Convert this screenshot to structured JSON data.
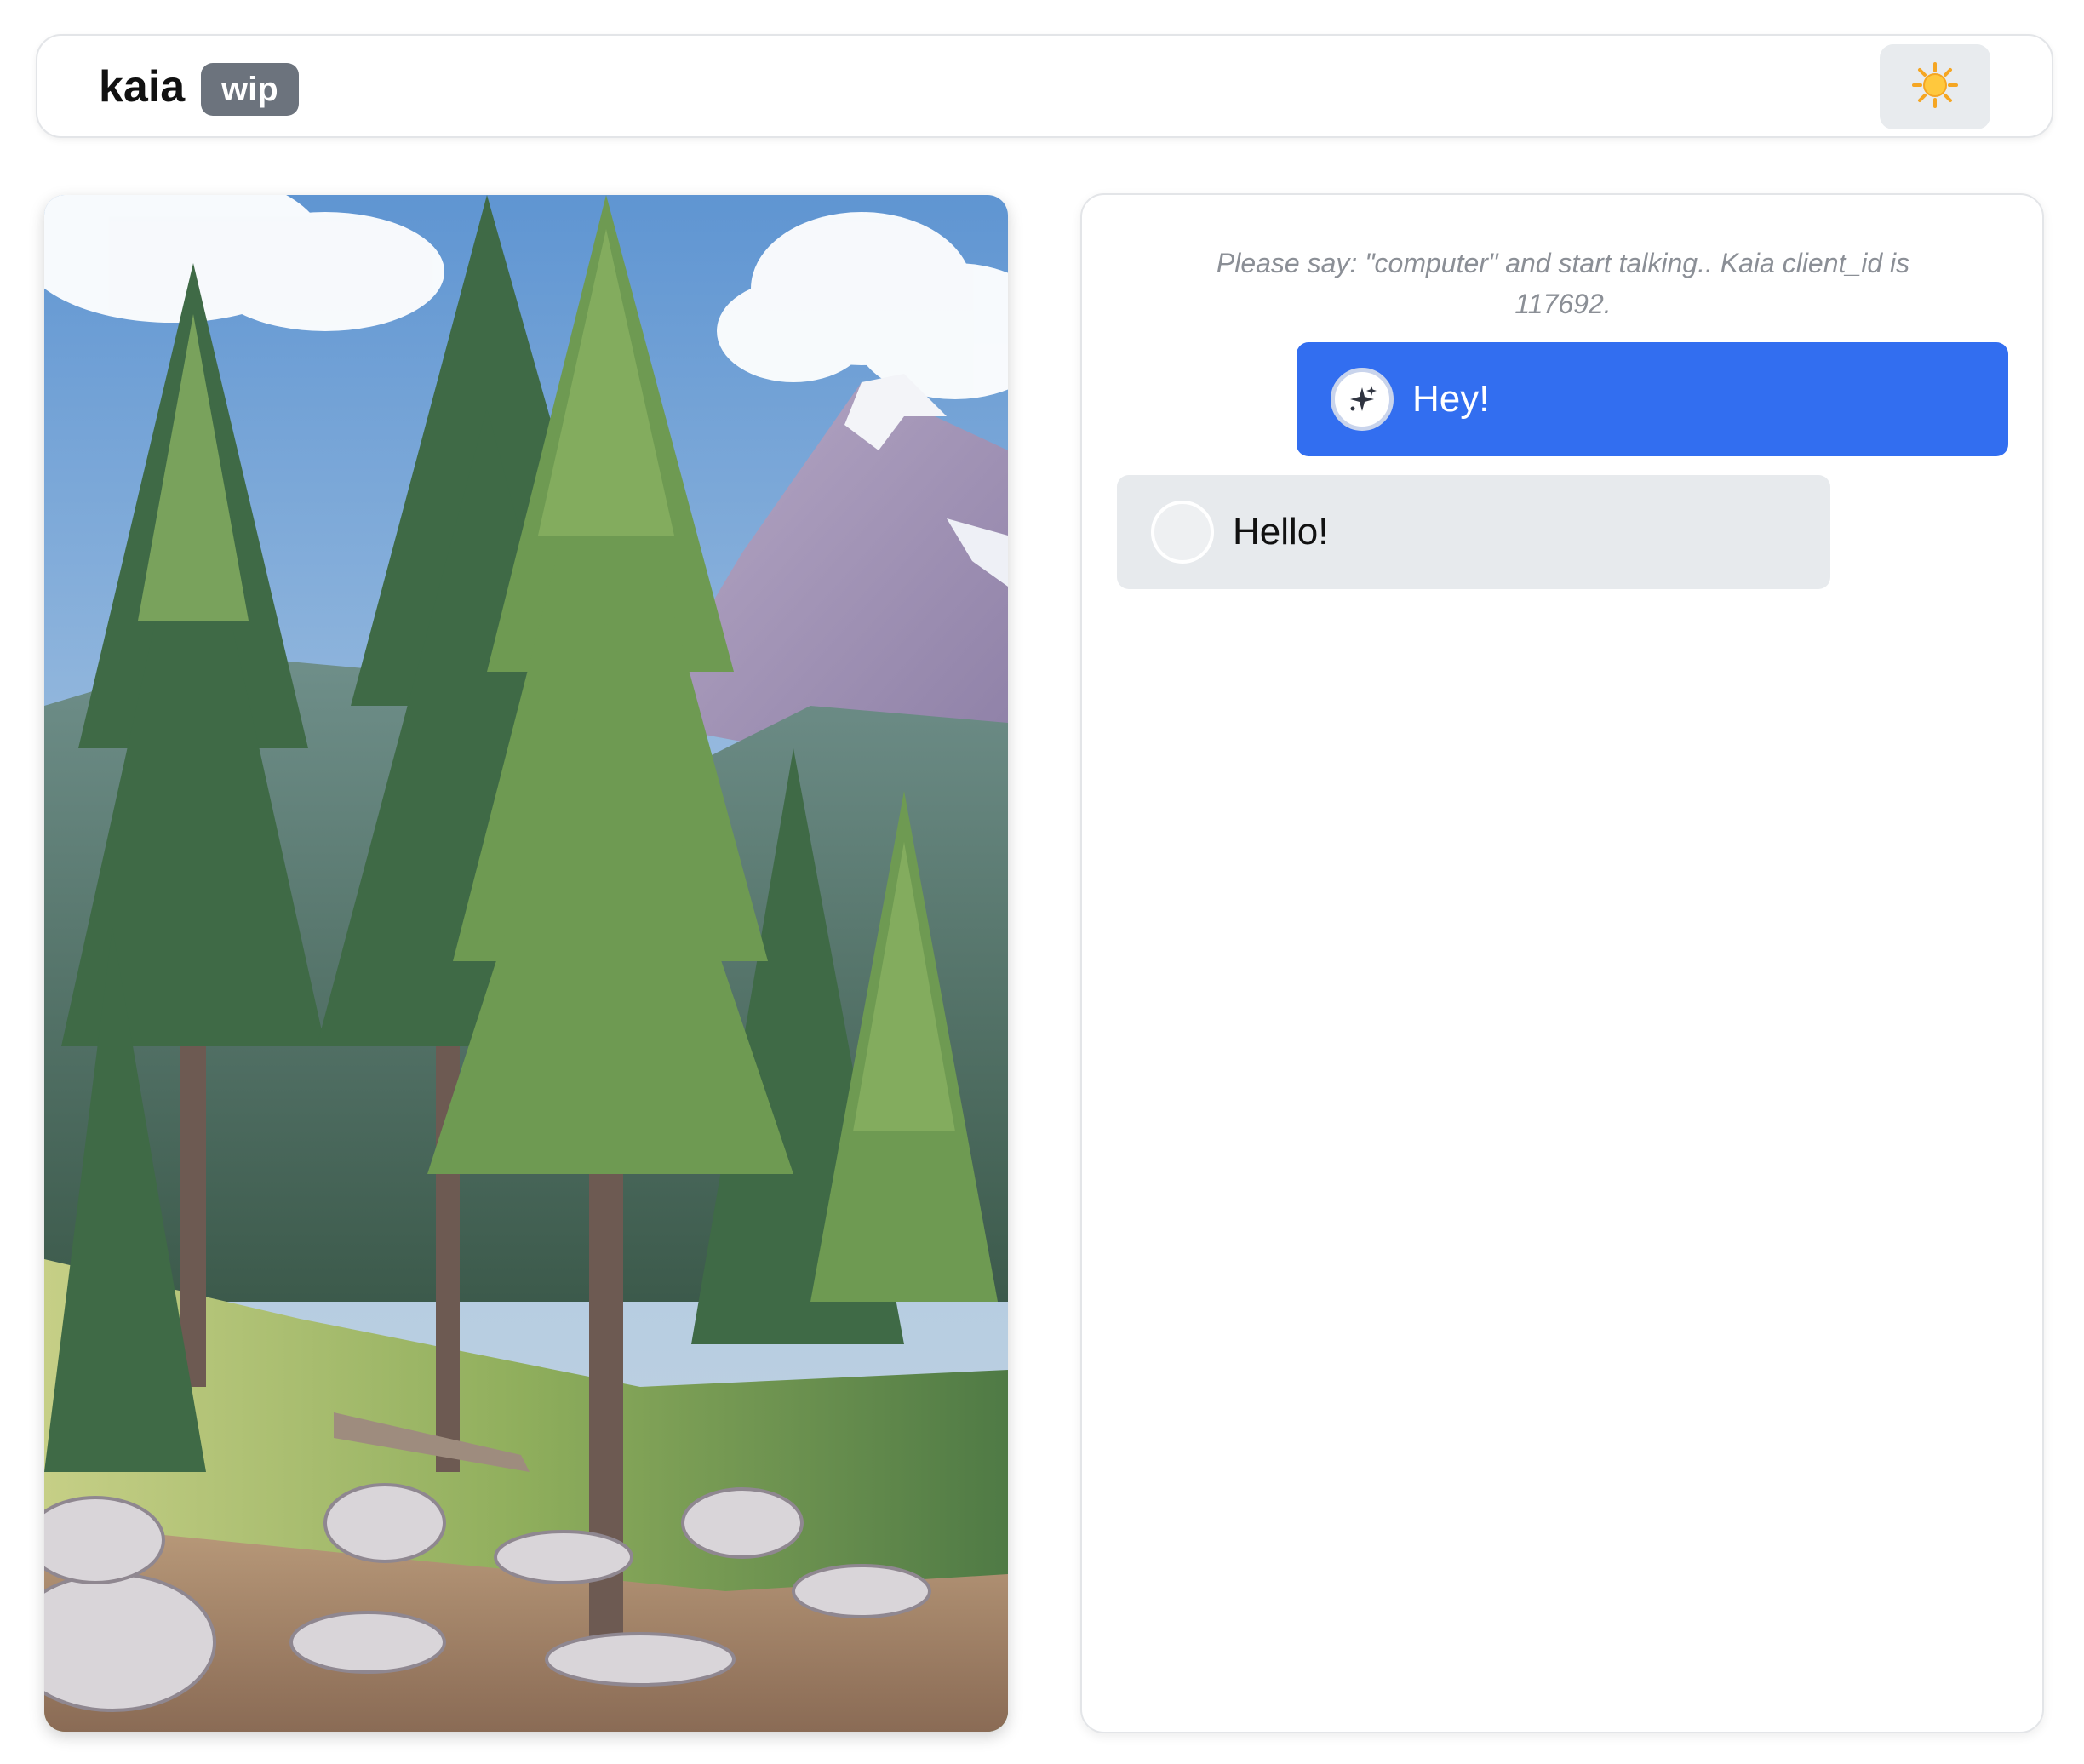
{
  "header": {
    "brand": "kaia",
    "badge": "wip",
    "theme_toggle_icon": "sun-icon"
  },
  "image_panel": {
    "subject": "illustration of pine forest, rocky stream bank and snowy mountain peak"
  },
  "chat": {
    "hint": "Please say: \"computer\" and start talking.. Kaia client_id is 117692.",
    "messages": [
      {
        "role": "user",
        "text": "Hey!",
        "icon": "sparkle-icon"
      },
      {
        "role": "assistant",
        "text": "Hello!",
        "icon": "avatar-circle-icon"
      }
    ]
  },
  "colors": {
    "user_bubble": "#326ef0",
    "assistant_bubble": "#e7eaed",
    "badge": "#6c737d"
  }
}
